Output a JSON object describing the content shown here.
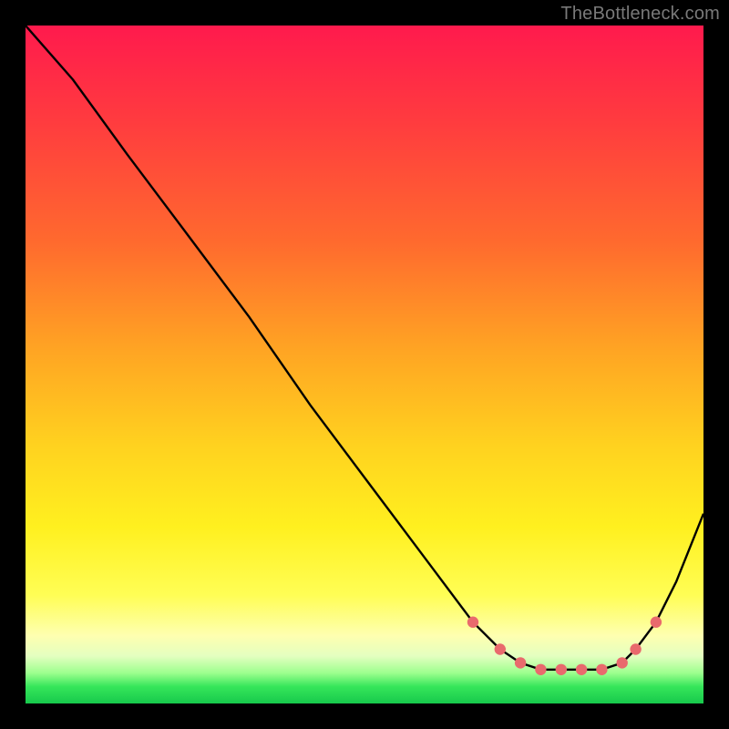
{
  "watermark": "TheBottleneck.com",
  "chart_data": {
    "type": "line",
    "title": "",
    "xlabel": "",
    "ylabel": "",
    "xlim": [
      0,
      100
    ],
    "ylim": [
      0,
      100
    ],
    "grid": false,
    "legend": false,
    "series": [
      {
        "name": "curve",
        "x": [
          0,
          7,
          15,
          24,
          33,
          42,
          51,
          60,
          66,
          70,
          73,
          76,
          79,
          82,
          85,
          88,
          90,
          93,
          96,
          100
        ],
        "y": [
          100,
          92,
          81,
          69,
          57,
          44,
          32,
          20,
          12,
          8,
          6,
          5,
          5,
          5,
          5,
          6,
          8,
          12,
          18,
          28
        ]
      }
    ],
    "markers": {
      "name": "dots",
      "x": [
        66,
        70,
        73,
        76,
        79,
        82,
        85,
        88,
        90,
        93
      ],
      "y": [
        12,
        8,
        6,
        5,
        5,
        5,
        5,
        6,
        8,
        12
      ]
    },
    "colors": {
      "curve": "#000000",
      "marker": "#e96a6d"
    }
  }
}
